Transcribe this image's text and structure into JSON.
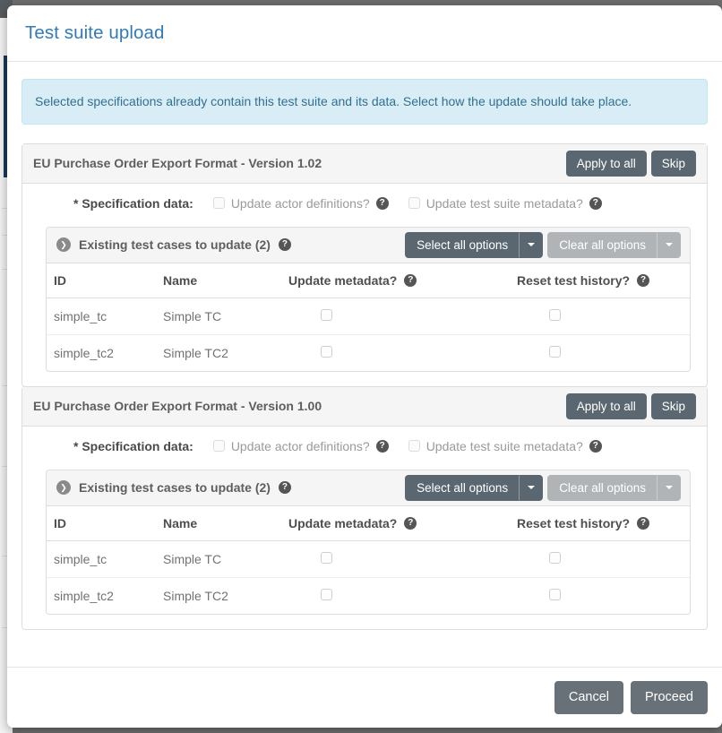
{
  "modal": {
    "title": "Test suite upload",
    "alert": "Selected specifications already contain this test suite and its data. Select how the update should take place.",
    "footer": {
      "cancel_label": "Cancel",
      "proceed_label": "Proceed"
    }
  },
  "icons": {
    "help": "?",
    "chevron_down": "❯",
    "caret_down": ""
  },
  "common": {
    "apply_to_all_label": "Apply to all",
    "skip_label": "Skip",
    "spec_data_label": "* Specification data:",
    "update_actor_definitions_label": "Update actor definitions?",
    "update_test_suite_metadata_label": "Update test suite metadata?",
    "select_all_label": "Select all options",
    "clear_all_label": "Clear all options",
    "table_headers": {
      "id": "ID",
      "name": "Name",
      "update_metadata": "Update metadata?",
      "reset_history": "Reset test history?"
    }
  },
  "colors": {
    "title_blue": "#337ab7",
    "alert_bg": "#d9edf7",
    "alert_border": "#bce8f1",
    "alert_text": "#31708f",
    "btn_slate": "#5b6770",
    "btn_grey": "#b0b4b7",
    "btn_footer": "#687078",
    "panel_head_bg": "#f5f5f5",
    "panel_border": "#dddddd"
  },
  "specifications": [
    {
      "title": "EU Purchase Order Export Format - Version 1.02",
      "test_cases_title": "Existing test cases to update (2)",
      "rows": [
        {
          "id": "simple_tc",
          "name": "Simple TC",
          "update_metadata": false,
          "reset_history": false
        },
        {
          "id": "simple_tc2",
          "name": "Simple TC2",
          "update_metadata": false,
          "reset_history": false
        }
      ]
    },
    {
      "title": "EU Purchase Order Export Format - Version 1.00",
      "test_cases_title": "Existing test cases to update (2)",
      "rows": [
        {
          "id": "simple_tc",
          "name": "Simple TC",
          "update_metadata": false,
          "reset_history": false
        },
        {
          "id": "simple_tc2",
          "name": "Simple TC2",
          "update_metadata": false,
          "reset_history": false
        }
      ]
    }
  ]
}
